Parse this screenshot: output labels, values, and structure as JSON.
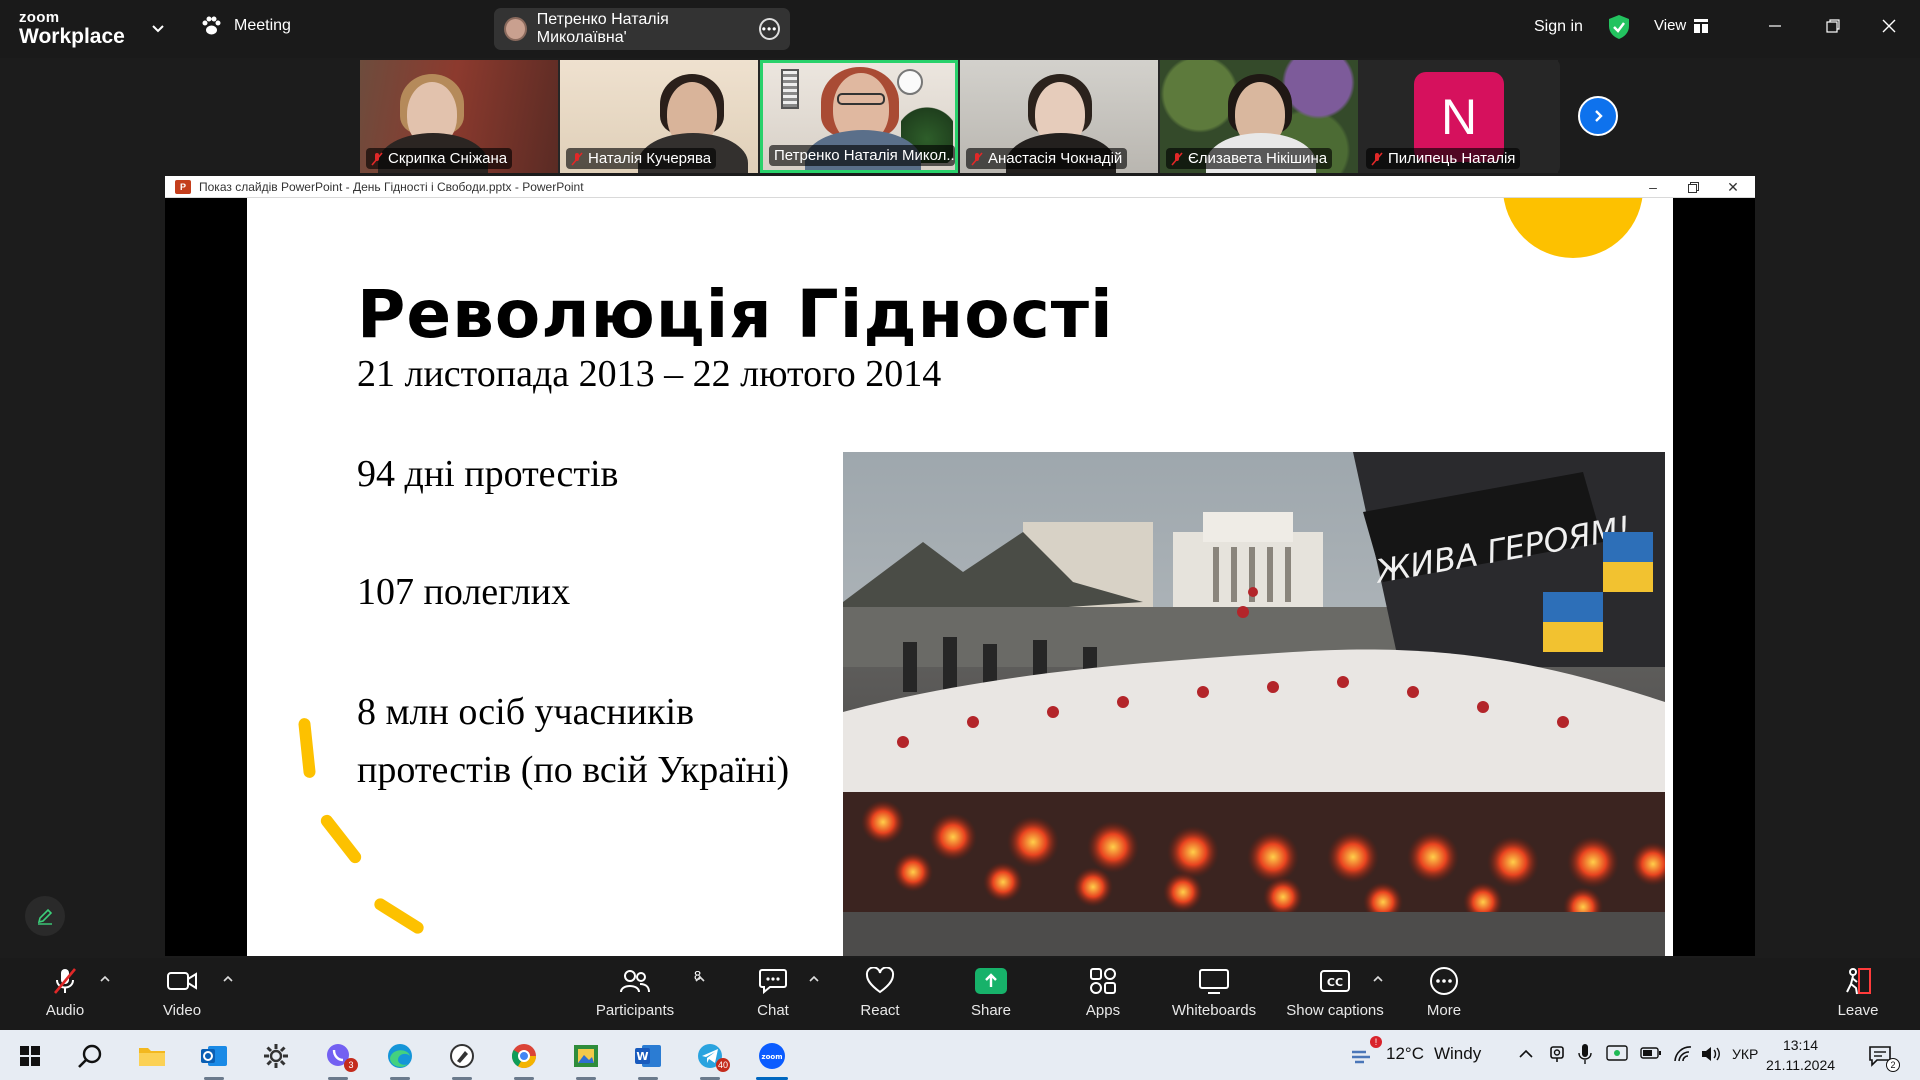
{
  "app": {
    "brand_top": "zoom",
    "brand_bottom": "Workplace",
    "meeting_label": "Meeting",
    "active_speaker": "Петренко Наталія Миколаївна'",
    "sign_in": "Sign in",
    "view_label": "View"
  },
  "participants": [
    {
      "name": "Скрипка Сніжана",
      "muted": true
    },
    {
      "name": "Наталія Кучерява",
      "muted": true
    },
    {
      "name": "Петренко Наталія Микол...",
      "muted": false,
      "active": true
    },
    {
      "name": "Анастасія Чокнадій",
      "muted": true
    },
    {
      "name": "Єлизавета Нікішина",
      "muted": true
    },
    {
      "name": "Пилипець Наталія",
      "muted": true,
      "avatar_letter": "N"
    }
  ],
  "powerpoint": {
    "window_title": "Показ слайдів PowerPoint  -  День Гідності і Свободи.pptx  -  PowerPoint"
  },
  "slide": {
    "title": "Революція Гідності",
    "dates": "21 листопада 2013 – 22 лютого 2014",
    "stat1": "94 дні протестів",
    "stat2": "107 полеглих",
    "stat3_line1": "8 млн осіб учасників",
    "stat3_line2": "протестів (по всій Україні)",
    "photo_sign": "ЖИВА ГЕРОЯМ!",
    "accent_color": "#fdc100"
  },
  "toolbar": {
    "audio": "Audio",
    "video": "Video",
    "participants": "Participants",
    "participants_count": "8",
    "chat": "Chat",
    "react": "React",
    "share": "Share",
    "apps": "Apps",
    "whiteboards": "Whiteboards",
    "captions": "Show captions",
    "captions_icon": "CC",
    "more": "More",
    "leave": "Leave",
    "share_color": "#17b26a"
  },
  "taskbar": {
    "viber_badge": "3",
    "telegram_badge": "40",
    "zoom_label": "zoom",
    "temperature": "12°C",
    "weather": "Windy",
    "language": "УКР",
    "time": "13:14",
    "date": "21.11.2024",
    "notifications": "2"
  }
}
